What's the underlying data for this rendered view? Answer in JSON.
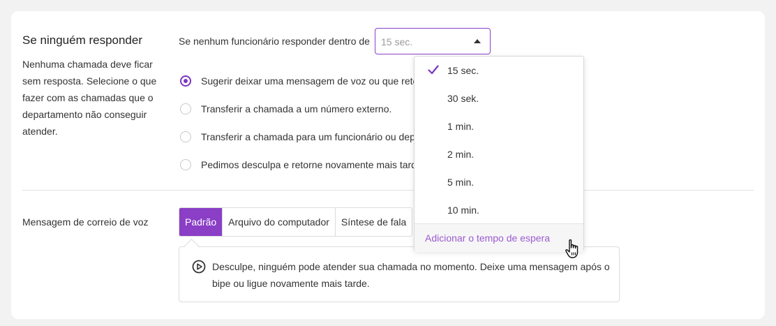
{
  "no_answer": {
    "title": "Se ninguém responder",
    "description": "Nenhuma chamada deve ficar sem resposta. Selecione o que fazer com as chamadas que o departamento não conseguir atender.",
    "timeout_label": "Se nenhum funcionário responder dentro de",
    "timeout_value": "15 sec.",
    "options": [
      {
        "label": "Sugerir deixar uma mensagem de voz ou que retorne",
        "checked": true
      },
      {
        "label": "Transferir a chamada a um número externo.",
        "checked": false
      },
      {
        "label": "Transferir a chamada para um funcionário ou departamento",
        "checked": false
      },
      {
        "label": "Pedimos desculpa e retorne novamente mais tarde",
        "checked": false
      }
    ]
  },
  "timeout_dropdown": {
    "items": [
      {
        "label": "15 sec.",
        "selected": true
      },
      {
        "label": "30 sek.",
        "selected": false
      },
      {
        "label": "1 min.",
        "selected": false
      },
      {
        "label": "2 min.",
        "selected": false
      },
      {
        "label": "5 min.",
        "selected": false
      },
      {
        "label": "10 min.",
        "selected": false
      }
    ],
    "footer": "Adicionar o tempo de espera"
  },
  "voicemail": {
    "label": "Mensagem de correio de voz",
    "tabs": [
      "Padrão",
      "Arquivo do computador",
      "Síntese de fala"
    ],
    "active_tab": "Padrão",
    "message": "Desculpe, ninguém pode atender sua chamada no momento. Deixe uma mensagem após o bipe ou ligue novamente mais tarde."
  },
  "colors": {
    "accent": "#8a3fc6",
    "footer_link": "#9b5bd0",
    "background": "#f1f2f1"
  }
}
